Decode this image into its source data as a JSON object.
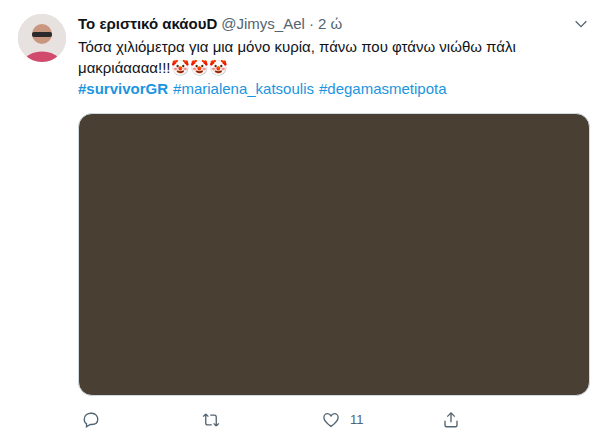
{
  "tweet": {
    "author": {
      "name": "Το εριστικό ακάουD",
      "handle": "@Jimys_Ael",
      "separator": "·",
      "time": "2 ώ"
    },
    "text": "Τόσα χιλιόμετρα για μια μόνο κυρία, πάνω που φτάνω νιώθω πάλι μακριάαααα!!!🤡🤡🤡",
    "hashtags": [
      {
        "text": "#survivorGR",
        "bold": true
      },
      {
        "text": "#marialena_katsoulis",
        "bold": false
      },
      {
        "text": "#degamasmetipota",
        "bold": false
      }
    ],
    "actions": [
      {
        "kind": "reply",
        "count": ""
      },
      {
        "kind": "retweet",
        "count": ""
      },
      {
        "kind": "like",
        "count": "11"
      },
      {
        "kind": "share",
        "count": ""
      }
    ]
  }
}
